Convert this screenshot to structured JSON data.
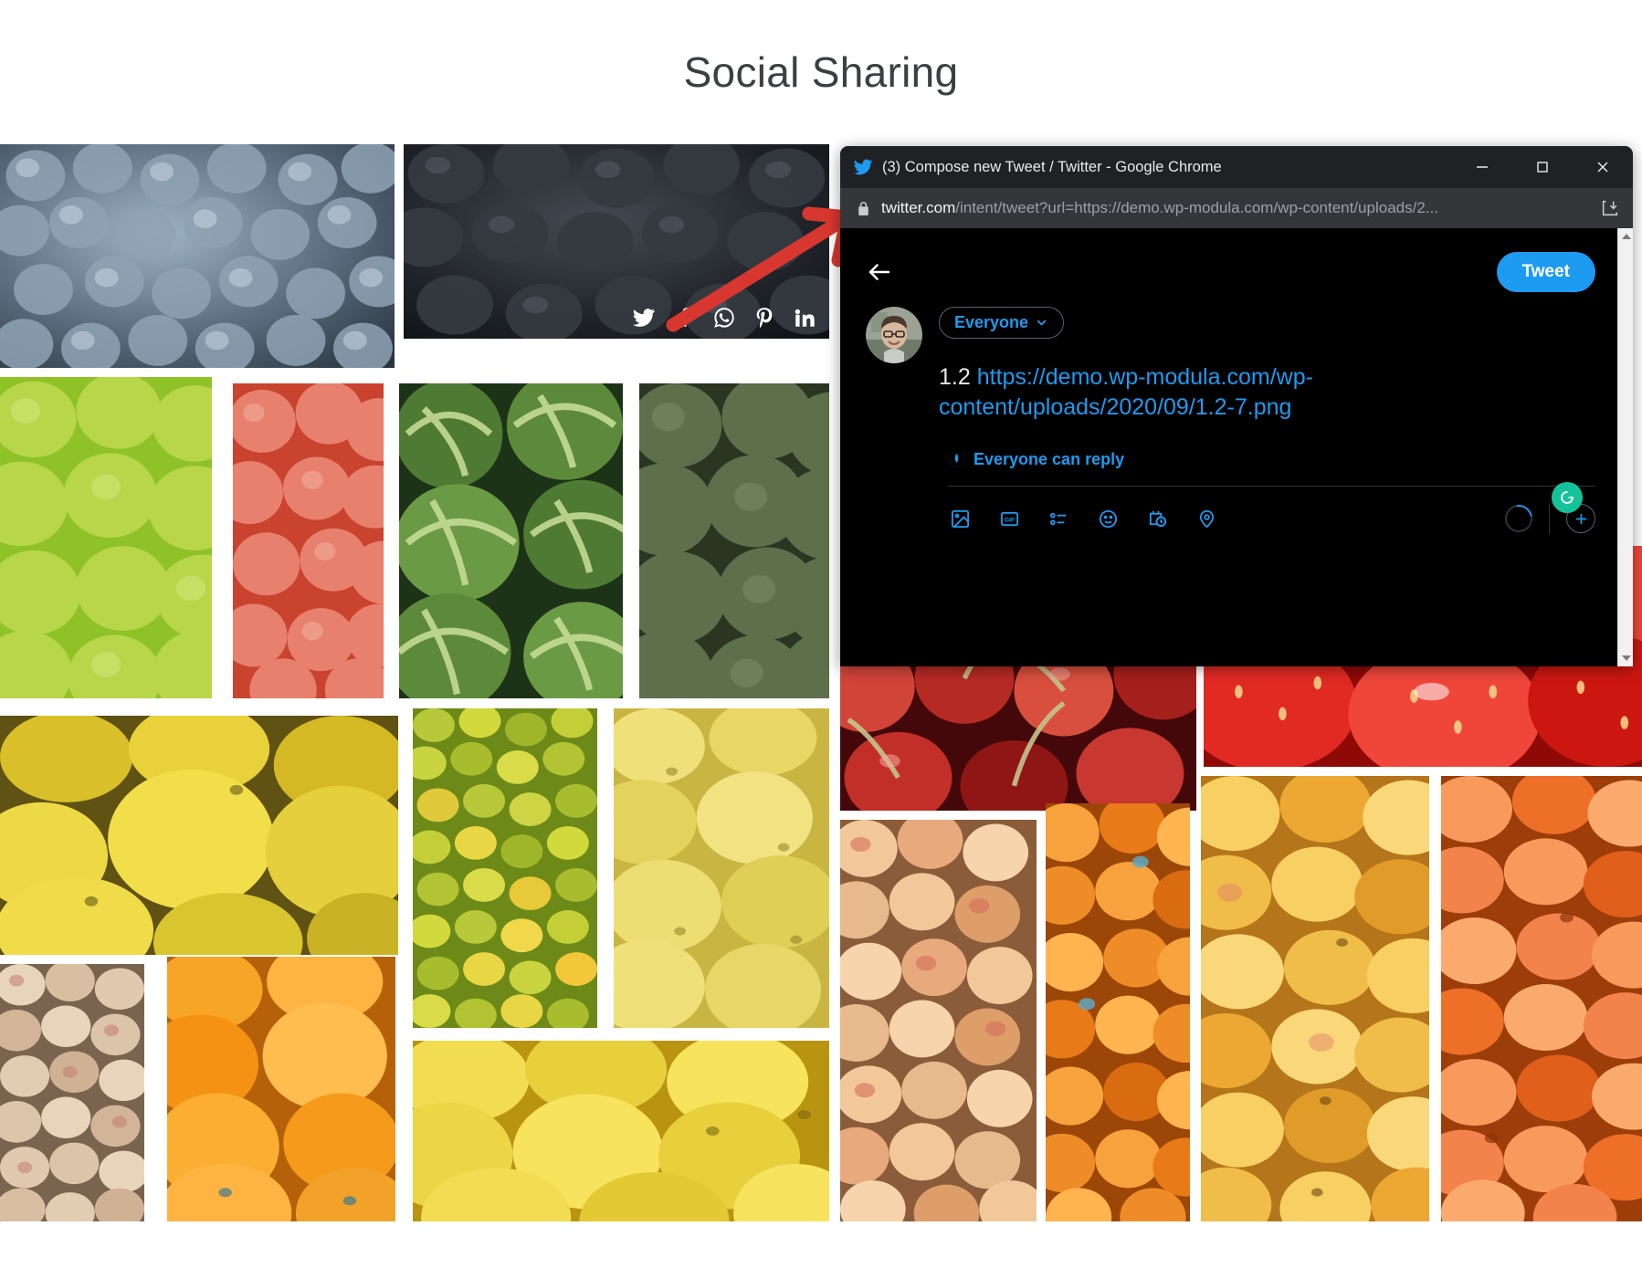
{
  "page": {
    "title": "Social Sharing",
    "background": "#ffffff"
  },
  "gallery": {
    "share_icons": [
      {
        "name": "twitter",
        "label": "Twitter"
      },
      {
        "name": "facebook",
        "label": "Facebook"
      },
      {
        "name": "whatsapp",
        "label": "WhatsApp"
      },
      {
        "name": "pinterest",
        "label": "Pinterest"
      },
      {
        "name": "linkedin",
        "label": "LinkedIn"
      }
    ],
    "tiles": [
      {
        "id": 1,
        "subject": "blueberries-light",
        "colors": [
          "#8fa3b5",
          "#4d5f70",
          "#2b3540"
        ]
      },
      {
        "id": 2,
        "subject": "blueberries-dark",
        "colors": [
          "#3a3f45",
          "#1d2126",
          "#0d0f12"
        ],
        "has_share_bar": true
      },
      {
        "id": 3,
        "subject": "limes",
        "colors": [
          "#b7d64a",
          "#8fc227",
          "#6ba015"
        ]
      },
      {
        "id": 4,
        "subject": "apples-red",
        "colors": [
          "#e8806e",
          "#d9543f",
          "#b63724"
        ]
      },
      {
        "id": 5,
        "subject": "watermelons",
        "colors": [
          "#9fbb6b",
          "#3f6b2f",
          "#1d3317"
        ]
      },
      {
        "id": 6,
        "subject": "green-melons",
        "colors": [
          "#7e8f68",
          "#4a5c3c",
          "#2a3622"
        ]
      },
      {
        "id": 7,
        "subject": "lemons-large",
        "colors": [
          "#f2d93c",
          "#d8b81c",
          "#8f7a13"
        ]
      },
      {
        "id": 8,
        "subject": "limes-pile",
        "colors": [
          "#d2d93c",
          "#9fb62a",
          "#6d8a18"
        ]
      },
      {
        "id": 9,
        "subject": "lemons-pale",
        "colors": [
          "#f0e07a",
          "#d9c64c",
          "#b3a231"
        ]
      },
      {
        "id": 10,
        "subject": "peaches-pale",
        "colors": [
          "#e8d4bb",
          "#c9a98a",
          "#9c7d60"
        ]
      },
      {
        "id": 11,
        "subject": "oranges-bright",
        "colors": [
          "#ffb340",
          "#f59213",
          "#c06c07"
        ]
      },
      {
        "id": 12,
        "subject": "lemons-wide",
        "colors": [
          "#f7d944",
          "#e8c324",
          "#c19b11"
        ]
      },
      {
        "id": 13,
        "subject": "cherries",
        "colors": [
          "#d94f3e",
          "#a51f1c",
          "#5c0d0c"
        ]
      },
      {
        "id": 14,
        "subject": "strawberries",
        "colors": [
          "#f0463a",
          "#cc1710",
          "#8f0a07"
        ]
      },
      {
        "id": 15,
        "subject": "apricots-pale",
        "colors": [
          "#f2c89a",
          "#dd9e69",
          "#b8764a"
        ]
      },
      {
        "id": 16,
        "subject": "oranges-small",
        "colors": [
          "#f7a23c",
          "#e87b18",
          "#bd5a0a"
        ]
      },
      {
        "id": 17,
        "subject": "apricots-yellow",
        "colors": [
          "#f7cf62",
          "#eda733",
          "#c97f18"
        ]
      },
      {
        "id": 18,
        "subject": "tangerines",
        "colors": [
          "#f79a5b",
          "#ee6f28",
          "#c44d12"
        ]
      }
    ]
  },
  "annotation": {
    "arrow_color": "#d8372f",
    "type": "pointer-arrow"
  },
  "chrome_window": {
    "title": "(3) Compose new Tweet / Twitter - Google Chrome",
    "favicon": "twitter-bird-icon",
    "controls": {
      "minimize": "Minimize",
      "maximize": "Maximize",
      "close": "Close"
    },
    "omnibox": {
      "lock_icon": "lock-icon",
      "url_host": "twitter.com",
      "url_path": "/intent/tweet?url=https://demo.wp-modula.com/wp-content/uploads/2...",
      "action_icon": "install-page-icon"
    }
  },
  "twitter": {
    "back_label": "Back",
    "tweet_button": "Tweet",
    "audience": {
      "label": "Everyone",
      "chevron": "chevron-down-icon"
    },
    "compose": {
      "prefix": "1.2",
      "link": "https://demo.wp-modula.com/wp-content/uploads/2020/09/1.2-7.png"
    },
    "reply_setting": {
      "icon": "globe-icon",
      "label": "Everyone can reply"
    },
    "toolbar_icons": [
      {
        "name": "media-icon",
        "label": "Media"
      },
      {
        "name": "gif-icon",
        "label": "GIF"
      },
      {
        "name": "poll-icon",
        "label": "Poll"
      },
      {
        "name": "emoji-icon",
        "label": "Emoji"
      },
      {
        "name": "schedule-icon",
        "label": "Schedule"
      },
      {
        "name": "location-icon",
        "label": "Location"
      }
    ],
    "add_tweet_label": "+",
    "grammarly": {
      "icon": "grammarly-icon",
      "color": "#15c39a"
    },
    "accent_color": "#1d9bf0",
    "background": "#000000"
  }
}
